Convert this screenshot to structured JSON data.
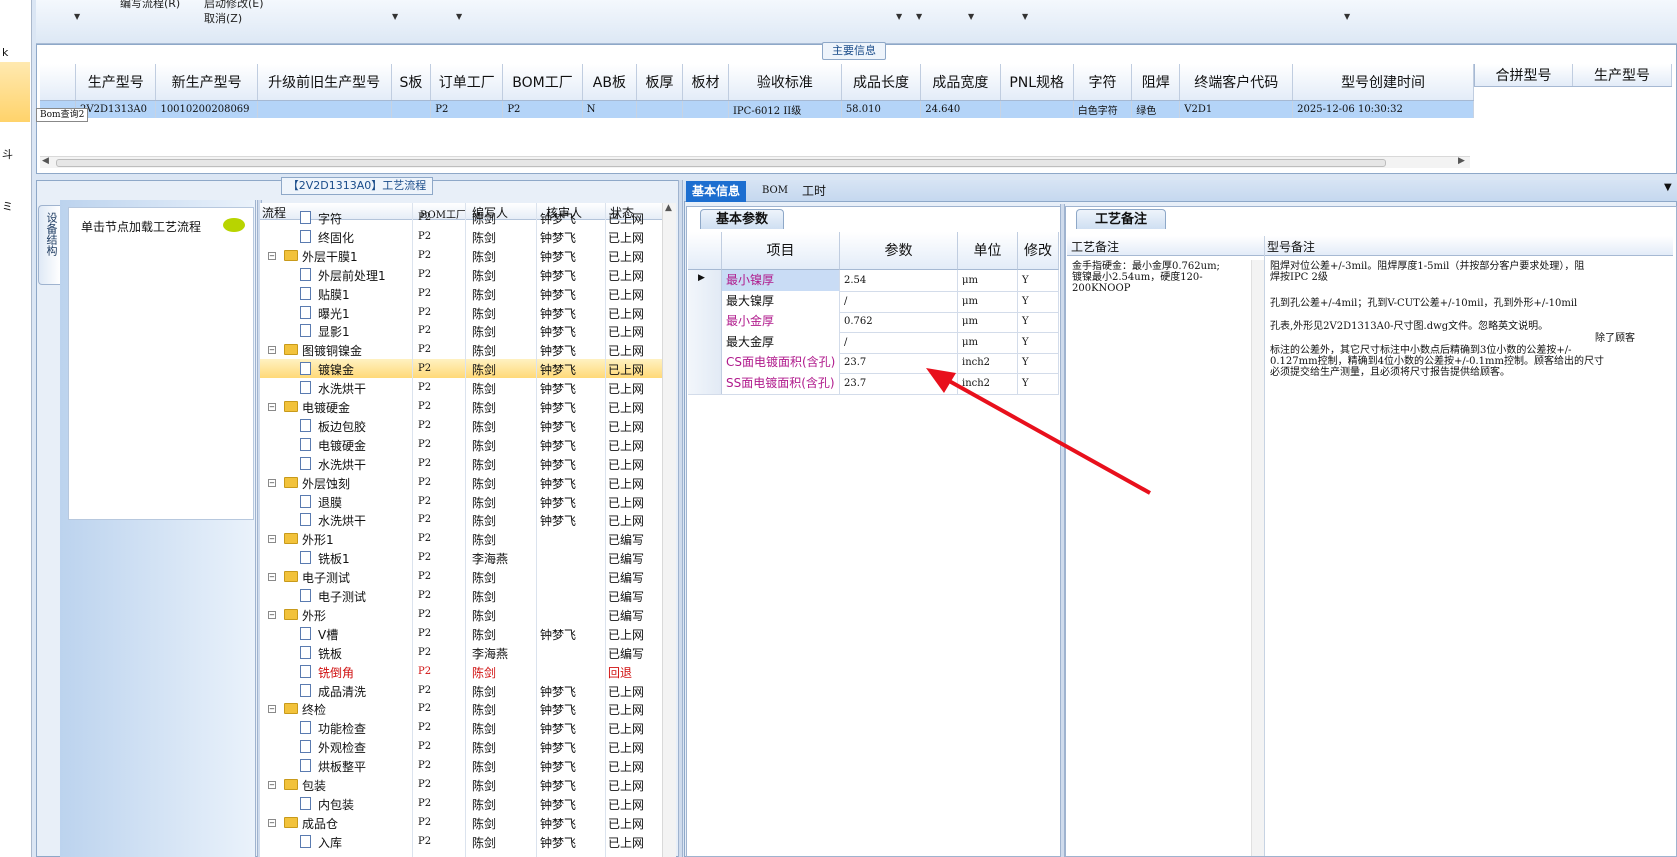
{
  "toolbar": {
    "item1": "编写流程(R)",
    "item2": "启动修改(E)",
    "item3": "取消(Z)"
  },
  "left_strip": {
    "c1": "k",
    "c2": "斗",
    "c3": "ミ"
  },
  "main_info": {
    "title": "主要信息",
    "columns": [
      "生产型号",
      "新生产型号",
      "升级前旧生产型号",
      "S板",
      "订单工厂",
      "BOM工厂",
      "AB板",
      "板厚",
      "板材",
      "验收标准",
      "成品长度",
      "成品宽度",
      "PNL规格",
      "字符",
      "阻焊",
      "终端客户代码",
      "型号创建时间"
    ],
    "row": [
      "2V2D1313A0",
      "10010200208069",
      "",
      "",
      "P2",
      "P2",
      "N",
      "",
      "",
      "IPC-6012 II级",
      "58.010",
      "24.640",
      "",
      "白色字符",
      "绿色",
      "V2D1",
      "2025-12-06 10:30:32"
    ],
    "tooltip": "Bom查询2",
    "right_columns": [
      "合拼型号",
      "生产型号"
    ]
  },
  "process": {
    "title": "【2V2D1313A0】工艺流程",
    "side_tab": "设备结构",
    "load_label": "单击节点加载工艺流程",
    "columns": [
      "流程",
      "BOM工厂",
      "编写人",
      "核审人",
      "状态"
    ],
    "rows": [
      {
        "level": 2,
        "type": "doc",
        "name": "字符",
        "bom": "P2",
        "writer": "陈剑",
        "reviewer": "钟梦飞",
        "status": "已上网"
      },
      {
        "level": 2,
        "type": "doc",
        "name": "终固化",
        "bom": "P2",
        "writer": "陈剑",
        "reviewer": "钟梦飞",
        "status": "已上网"
      },
      {
        "level": 1,
        "type": "folder",
        "name": "外层干膜1",
        "bom": "P2",
        "writer": "陈剑",
        "reviewer": "钟梦飞",
        "status": "已上网"
      },
      {
        "level": 2,
        "type": "doc",
        "name": "外层前处理1",
        "bom": "P2",
        "writer": "陈剑",
        "reviewer": "钟梦飞",
        "status": "已上网"
      },
      {
        "level": 2,
        "type": "doc",
        "name": "贴膜1",
        "bom": "P2",
        "writer": "陈剑",
        "reviewer": "钟梦飞",
        "status": "已上网"
      },
      {
        "level": 2,
        "type": "doc",
        "name": "曝光1",
        "bom": "P2",
        "writer": "陈剑",
        "reviewer": "钟梦飞",
        "status": "已上网"
      },
      {
        "level": 2,
        "type": "doc",
        "name": "显影1",
        "bom": "P2",
        "writer": "陈剑",
        "reviewer": "钟梦飞",
        "status": "已上网"
      },
      {
        "level": 1,
        "type": "folder",
        "name": "图镀铜镍金",
        "bom": "P2",
        "writer": "陈剑",
        "reviewer": "钟梦飞",
        "status": "已上网"
      },
      {
        "level": 2,
        "type": "doc",
        "name": "镀镍金",
        "bom": "P2",
        "writer": "陈剑",
        "reviewer": "钟梦飞",
        "status": "已上网",
        "selected": true
      },
      {
        "level": 2,
        "type": "doc",
        "name": "水洗烘干",
        "bom": "P2",
        "writer": "陈剑",
        "reviewer": "钟梦飞",
        "status": "已上网"
      },
      {
        "level": 1,
        "type": "folder",
        "name": "电镀硬金",
        "bom": "P2",
        "writer": "陈剑",
        "reviewer": "钟梦飞",
        "status": "已上网"
      },
      {
        "level": 2,
        "type": "doc",
        "name": "板边包胶",
        "bom": "P2",
        "writer": "陈剑",
        "reviewer": "钟梦飞",
        "status": "已上网"
      },
      {
        "level": 2,
        "type": "doc",
        "name": "电镀硬金",
        "bom": "P2",
        "writer": "陈剑",
        "reviewer": "钟梦飞",
        "status": "已上网"
      },
      {
        "level": 2,
        "type": "doc",
        "name": "水洗烘干",
        "bom": "P2",
        "writer": "陈剑",
        "reviewer": "钟梦飞",
        "status": "已上网"
      },
      {
        "level": 1,
        "type": "folder",
        "name": "外层蚀刻",
        "bom": "P2",
        "writer": "陈剑",
        "reviewer": "钟梦飞",
        "status": "已上网"
      },
      {
        "level": 2,
        "type": "doc",
        "name": "退膜",
        "bom": "P2",
        "writer": "陈剑",
        "reviewer": "钟梦飞",
        "status": "已上网"
      },
      {
        "level": 2,
        "type": "doc",
        "name": "水洗烘干",
        "bom": "P2",
        "writer": "陈剑",
        "reviewer": "钟梦飞",
        "status": "已上网"
      },
      {
        "level": 1,
        "type": "folder",
        "name": "外形1",
        "bom": "P2",
        "writer": "陈剑",
        "reviewer": "",
        "status": "已编写"
      },
      {
        "level": 2,
        "type": "doc",
        "name": "铣板1",
        "bom": "P2",
        "writer": "李海燕",
        "reviewer": "",
        "status": "已编写"
      },
      {
        "level": 1,
        "type": "folder",
        "name": "电子测试",
        "bom": "P2",
        "writer": "陈剑",
        "reviewer": "",
        "status": "已编写"
      },
      {
        "level": 2,
        "type": "doc",
        "name": "电子测试",
        "bom": "P2",
        "writer": "陈剑",
        "reviewer": "",
        "status": "已编写"
      },
      {
        "level": 1,
        "type": "folder",
        "name": "外形",
        "bom": "P2",
        "writer": "陈剑",
        "reviewer": "",
        "status": "已编写"
      },
      {
        "level": 2,
        "type": "doc",
        "name": "V槽",
        "bom": "P2",
        "writer": "陈剑",
        "reviewer": "钟梦飞",
        "status": "已上网"
      },
      {
        "level": 2,
        "type": "doc",
        "name": "铣板",
        "bom": "P2",
        "writer": "李海燕",
        "reviewer": "",
        "status": "已编写"
      },
      {
        "level": 2,
        "type": "doc",
        "name": "铣倒角",
        "bom": "P2",
        "writer": "陈剑",
        "reviewer": "",
        "status": "回退",
        "red": true
      },
      {
        "level": 2,
        "type": "doc",
        "name": "成品清洗",
        "bom": "P2",
        "writer": "陈剑",
        "reviewer": "钟梦飞",
        "status": "已上网"
      },
      {
        "level": 1,
        "type": "folder",
        "name": "终检",
        "bom": "P2",
        "writer": "陈剑",
        "reviewer": "钟梦飞",
        "status": "已上网"
      },
      {
        "level": 2,
        "type": "doc",
        "name": "功能检查",
        "bom": "P2",
        "writer": "陈剑",
        "reviewer": "钟梦飞",
        "status": "已上网"
      },
      {
        "level": 2,
        "type": "doc",
        "name": "外观检查",
        "bom": "P2",
        "writer": "陈剑",
        "reviewer": "钟梦飞",
        "status": "已上网"
      },
      {
        "level": 2,
        "type": "doc",
        "name": "烘板整平",
        "bom": "P2",
        "writer": "陈剑",
        "reviewer": "钟梦飞",
        "status": "已上网"
      },
      {
        "level": 1,
        "type": "folder",
        "name": "包装",
        "bom": "P2",
        "writer": "陈剑",
        "reviewer": "钟梦飞",
        "status": "已上网"
      },
      {
        "level": 2,
        "type": "doc",
        "name": "内包装",
        "bom": "P2",
        "writer": "陈剑",
        "reviewer": "钟梦飞",
        "status": "已上网"
      },
      {
        "level": 1,
        "type": "folder",
        "name": "成品仓",
        "bom": "P2",
        "writer": "陈剑",
        "reviewer": "钟梦飞",
        "status": "已上网"
      },
      {
        "level": 2,
        "type": "doc",
        "name": "入库",
        "bom": "P2",
        "writer": "陈剑",
        "reviewer": "钟梦飞",
        "status": "已上网"
      }
    ]
  },
  "tabs": [
    "基本信息",
    "BOM",
    "工时"
  ],
  "basic_params": {
    "subtab": "基本参数",
    "columns": [
      "项目",
      "参数",
      "单位",
      "修改"
    ],
    "rows": [
      {
        "item": "最小镍厚",
        "value": "2.54",
        "unit": "μm",
        "mod": "Y",
        "pink": true,
        "current": true
      },
      {
        "item": "最大镍厚",
        "value": "/",
        "unit": "μm",
        "mod": "Y",
        "pink": false
      },
      {
        "item": "最小金厚",
        "value": "0.762",
        "unit": "μm",
        "mod": "Y",
        "pink": true
      },
      {
        "item": "最大金厚",
        "value": "/",
        "unit": "μm",
        "mod": "Y",
        "pink": false
      },
      {
        "item": "CS面电镀面积(含孔)",
        "value": "23.7",
        "unit": "inch2",
        "mod": "Y",
        "pink": true
      },
      {
        "item": "SS面电镀面积(含孔)",
        "value": "23.7",
        "unit": "inch2",
        "mod": "Y",
        "pink": true
      }
    ]
  },
  "remarks": {
    "subtab": "工艺备注",
    "col1": "工艺备注",
    "col2": "型号备注",
    "process_note": "金手指硬金：最小金厚0.762um;\n镀镍最小2.54um，硬度120-\n200KNOOP",
    "model_note_1": "阻焊对位公差+/-3mil。阻焊厚度1-5mil（并按部分客户要求处理），阻\n焊按IPC 2级",
    "model_note_2": "孔到孔公差+/-4mil；孔到V-CUT公差+/-10mil，孔到外形+/-10mil",
    "model_note_3": "孔表,外形见2V2D1313A0-尺寸图.dwg文件。忽略英文说明。",
    "model_note_4": "除了顾客",
    "model_note_5": "标注的公差外，其它尺寸标注中小数点后精确到3位小数的公差按+/-\n0.127mm控制，精确到4位小数的公差按+/-0.1mm控制。顾客给出的尺寸\n必须提交给生产测量，且必须将尺寸报告提供给顾客。"
  },
  "colors": {
    "accent": "#1c6ed0",
    "selection": "#b4d4f8",
    "pink_label": "#b01a8c",
    "arrow": "#e8101c"
  }
}
